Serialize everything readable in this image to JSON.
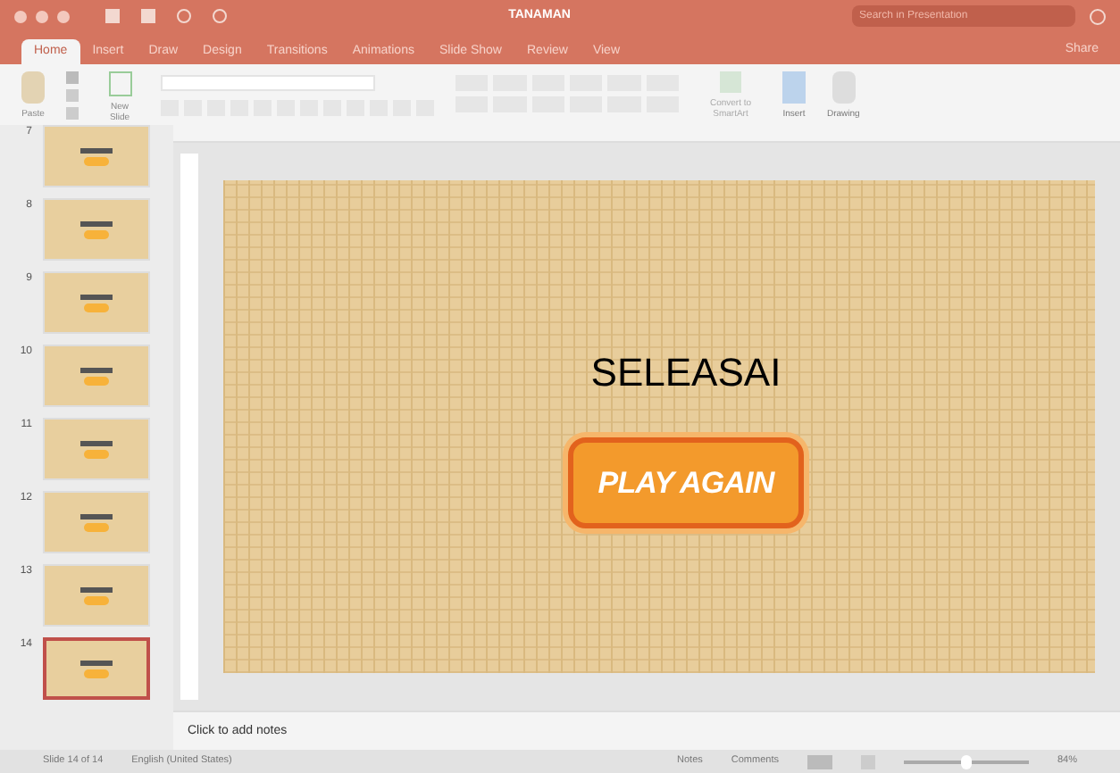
{
  "window": {
    "title": "TANAMAN",
    "search": {
      "placeholder": "Search in Presentation"
    }
  },
  "tabs": [
    {
      "label": "Home",
      "selected": true
    },
    {
      "label": "Insert",
      "selected": false
    },
    {
      "label": "Draw",
      "selected": false
    },
    {
      "label": "Design",
      "selected": false
    },
    {
      "label": "Transitions",
      "selected": false
    },
    {
      "label": "Animations",
      "selected": false
    },
    {
      "label": "Slide Show",
      "selected": false
    },
    {
      "label": "Review",
      "selected": false
    },
    {
      "label": "View",
      "selected": false
    }
  ],
  "share": "Share",
  "ribbon": {
    "paste": "Paste",
    "new_slide": "New Slide",
    "convert": "Convert to SmartArt",
    "insert": "Insert",
    "drawing": "Drawing"
  },
  "slides": [
    {
      "number": "7",
      "selected": false
    },
    {
      "number": "8",
      "selected": false
    },
    {
      "number": "9",
      "selected": false
    },
    {
      "number": "10",
      "selected": false
    },
    {
      "number": "11",
      "selected": false
    },
    {
      "number": "12",
      "selected": false
    },
    {
      "number": "13",
      "selected": false
    },
    {
      "number": "14",
      "selected": true
    }
  ],
  "slide": {
    "title": "SELEASAI",
    "button": "PLAY AGAIN"
  },
  "notes": {
    "placeholder": "Click to add notes"
  },
  "status_bar": {
    "slide": "Slide 14 of 14",
    "language": "English (United States)",
    "notes": "Notes",
    "comments": "Comments",
    "zoom": "84%",
    "level": 0.5
  }
}
